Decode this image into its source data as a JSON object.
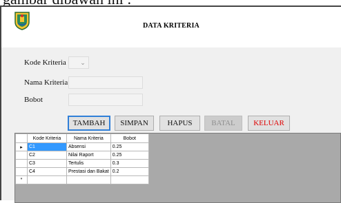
{
  "caption": "gambar dibawah ini :",
  "window": {
    "title": "DATA KRITERIA"
  },
  "form": {
    "kode_label": "Kode Kriteria",
    "kode_value": "",
    "nama_label": "Nama Kriteria",
    "nama_value": "",
    "bobot_label": "Bobot",
    "bobot_value": ""
  },
  "buttons": {
    "tambah": "TAMBAH",
    "simpan": "SIMPAN",
    "hapus": "HAPUS",
    "batal": "BATAL",
    "keluar": "KELUAR"
  },
  "grid": {
    "columns": [
      "Kode Kriteria",
      "Nama Kriteria",
      "Bobot"
    ],
    "rows": [
      {
        "marker": "▸",
        "kode": "C1",
        "nama": "Absensi",
        "bobot": "0.25"
      },
      {
        "marker": "",
        "kode": "C2",
        "nama": "Nilai Raport",
        "bobot": "0.25"
      },
      {
        "marker": "",
        "kode": "C3",
        "nama": "Tertulis",
        "bobot": "0.3"
      },
      {
        "marker": "",
        "kode": "C4",
        "nama": "Prestasi dan Bakat",
        "bobot": "0.2"
      }
    ],
    "new_row_marker": "*"
  },
  "colors": {
    "selected_cell": "#3399ff",
    "keluar_text": "#e00000",
    "accent_border": "#2f7fd8"
  }
}
